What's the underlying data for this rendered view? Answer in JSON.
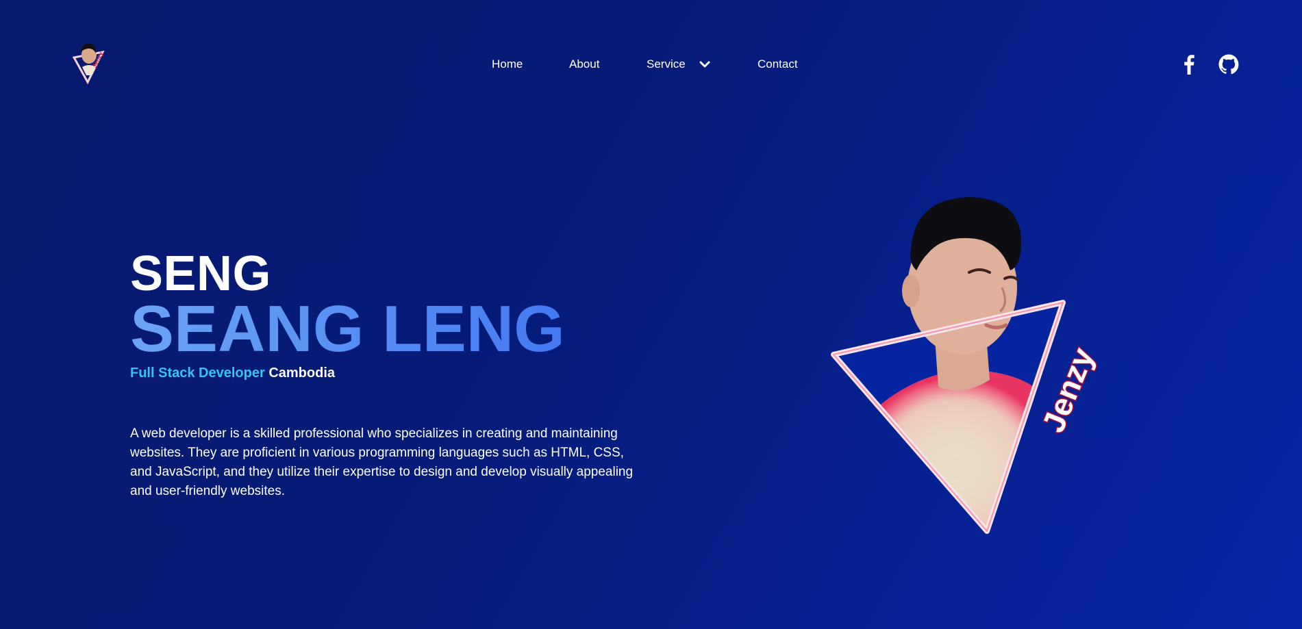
{
  "nav": {
    "items": [
      {
        "label": "Home"
      },
      {
        "label": "About"
      },
      {
        "label": "Service"
      },
      {
        "label": "Contact"
      }
    ]
  },
  "socials": [
    {
      "icon": "facebook-icon"
    },
    {
      "icon": "github-icon"
    }
  ],
  "hero": {
    "first_name": "SENG",
    "last_name": "SEANG LENG",
    "role": "Full Stack Developer",
    "location": "Cambodia",
    "bio": "A web developer is a skilled professional who specializes in creating and maintaining websites. They are proficient in various programming languages such as HTML, CSS, and JavaScript, and they utilize their expertise to design and develop visually appealing and user-friendly websites."
  },
  "portrait": {
    "signature": "Jenzy"
  },
  "colors": {
    "background": "#061b78",
    "accent": "#5b93f5",
    "role": "#35c4f0",
    "signature": "#e8174f"
  }
}
